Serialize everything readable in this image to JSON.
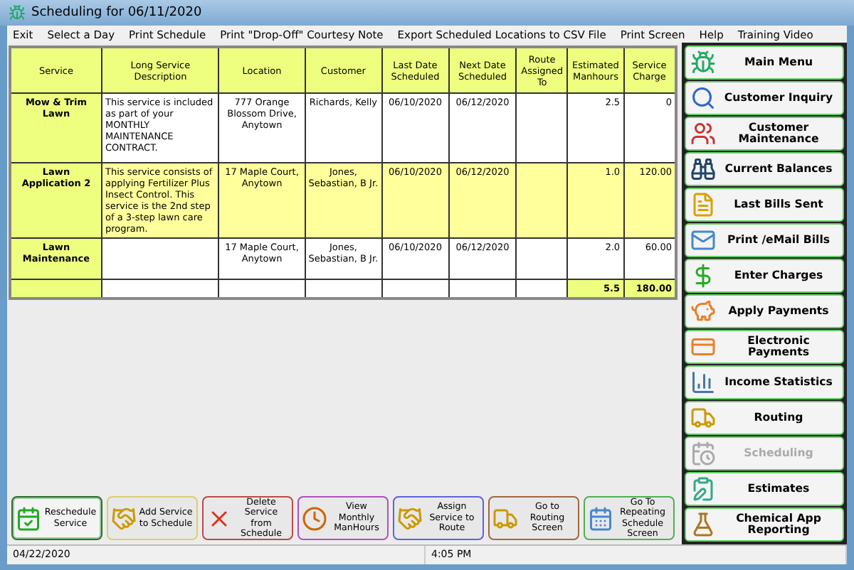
{
  "window": {
    "title": "Scheduling for 06/11/2020"
  },
  "menu": [
    "Exit",
    "Select a Day",
    "Print Schedule",
    "Print \"Drop-Off\" Courtesy Note",
    "Export Scheduled Locations to CSV File",
    "Print Screen",
    "Help",
    "Training Video"
  ],
  "table": {
    "columns": [
      "Service",
      "Long Service Description",
      "Location",
      "Customer",
      "Last Date Scheduled",
      "Next Date Scheduled",
      "Route Assigned To",
      "Estimated Manhours",
      "Service Charge"
    ],
    "rows": [
      {
        "selected": false,
        "cells": [
          "Mow & Trim Lawn",
          "This service is included as part of your MONTHLY MAINTENANCE CONTRACT.",
          "777 Orange Blossom Drive, Anytown",
          "Richards, Kelly",
          "06/10/2020",
          "06/12/2020",
          "",
          "2.5",
          "0"
        ]
      },
      {
        "selected": true,
        "cells": [
          "Lawn Application 2",
          "This service consists of applying Fertilizer Plus Insect Control.  This service is the 2nd step of a 3-step lawn care program.",
          "17 Maple Court, Anytown",
          "Jones, Sebastian, B Jr.",
          "06/10/2020",
          "06/12/2020",
          "",
          "1.0",
          "120.00"
        ]
      },
      {
        "selected": false,
        "cells": [
          "Lawn Maintenance",
          "",
          "17 Maple Court, Anytown",
          "Jones, Sebastian, B Jr.",
          "06/10/2020",
          "06/12/2020",
          "",
          "2.0",
          "60.00"
        ]
      }
    ],
    "totals": [
      "5.5",
      "180.00"
    ]
  },
  "toolbar": [
    {
      "label": "Reschedule Service",
      "color": "#2e6b34",
      "selected": true
    },
    {
      "label": "Add Service to Schedule",
      "color": "#d8d070",
      "selected": false
    },
    {
      "label": "Delete Service from Schedule",
      "color": "#c04848",
      "selected": false
    },
    {
      "label": "View Monthly ManHours",
      "color": "#b050c0",
      "selected": false
    },
    {
      "label": "Assign Service to Route",
      "color": "#6060e0",
      "selected": false
    },
    {
      "label": "Go to Routing Screen",
      "color": "#a06840",
      "selected": false
    },
    {
      "label": "Go To Repeating Schedule Screen",
      "color": "#50b050",
      "selected": false
    }
  ],
  "sidebar": [
    {
      "label": "Main Menu",
      "disabled": false
    },
    {
      "label": "Customer Inquiry",
      "disabled": false
    },
    {
      "label": "Customer Maintenance",
      "disabled": false
    },
    {
      "label": "Current Balances",
      "disabled": false
    },
    {
      "label": "Last Bills Sent",
      "disabled": false
    },
    {
      "label": "Print /eMail Bills",
      "disabled": false
    },
    {
      "label": "Enter Charges",
      "disabled": false
    },
    {
      "label": "Apply Payments",
      "disabled": false
    },
    {
      "label": "Electronic Payments",
      "disabled": false
    },
    {
      "label": "Income Statistics",
      "disabled": false
    },
    {
      "label": "Routing",
      "disabled": false
    },
    {
      "label": "Scheduling",
      "disabled": true
    },
    {
      "label": "Estimates",
      "disabled": false
    },
    {
      "label": "Chemical App Reporting",
      "disabled": false
    }
  ],
  "status_bar": [
    "04/22/2020",
    "4:05 PM"
  ]
}
